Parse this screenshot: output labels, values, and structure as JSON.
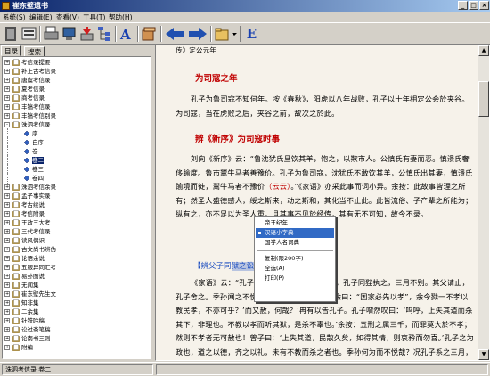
{
  "window": {
    "title": "崔东壁遗书"
  },
  "menu": [
    "系统(S)",
    "编辑(E)",
    "查看(V)",
    "工具(T)",
    "帮助(H)"
  ],
  "toolbar": {
    "e_label": "E"
  },
  "left_tabs": [
    "目录",
    "搜索"
  ],
  "tree": [
    {
      "label": "考信录提要",
      "depth": 0,
      "expander": "+"
    },
    {
      "label": "补上古考信录",
      "depth": 0,
      "expander": "+"
    },
    {
      "label": "唐虞考信录",
      "depth": 0,
      "expander": "+"
    },
    {
      "label": "夏考信录",
      "depth": 0,
      "expander": "+"
    },
    {
      "label": "商考信录",
      "depth": 0,
      "expander": "+"
    },
    {
      "label": "丰镐考信录",
      "depth": 0,
      "expander": "+"
    },
    {
      "label": "丰镐考信别录",
      "depth": 0,
      "expander": "+"
    },
    {
      "label": "洙泗考信录",
      "depth": 0,
      "expander": "-"
    },
    {
      "label": "序",
      "depth": 1,
      "expander": ""
    },
    {
      "label": "自序",
      "depth": 1,
      "expander": ""
    },
    {
      "label": "卷一",
      "depth": 1,
      "expander": ""
    },
    {
      "label": "卷二",
      "depth": 1,
      "expander": "",
      "selected": true
    },
    {
      "label": "卷三",
      "depth": 1,
      "expander": ""
    },
    {
      "label": "卷四",
      "depth": 1,
      "expander": ""
    },
    {
      "label": "洙泗考信余录",
      "depth": 0,
      "expander": "+"
    },
    {
      "label": "孟子事实录",
      "depth": 0,
      "expander": "+"
    },
    {
      "label": "考古续说",
      "depth": 0,
      "expander": "+"
    },
    {
      "label": "考信附录",
      "depth": 0,
      "expander": "+"
    },
    {
      "label": "王政三大考",
      "depth": 0,
      "expander": "+"
    },
    {
      "label": "三代考信录",
      "depth": 0,
      "expander": "+"
    },
    {
      "label": "读风偶识",
      "depth": 0,
      "expander": "+"
    },
    {
      "label": "古文尚书辨伪",
      "depth": 0,
      "expander": "+"
    },
    {
      "label": "论语余说",
      "depth": 0,
      "expander": "+"
    },
    {
      "label": "五服异同汇考",
      "depth": 0,
      "expander": "+"
    },
    {
      "label": "易卦图说",
      "depth": 0,
      "expander": "+"
    },
    {
      "label": "无闻集",
      "depth": 0,
      "expander": "+"
    },
    {
      "label": "崔东壁先生文",
      "depth": 0,
      "expander": "+"
    },
    {
      "label": "知非集",
      "depth": 0,
      "expander": "+"
    },
    {
      "label": "二余集",
      "depth": 0,
      "expander": "+"
    },
    {
      "label": "针铁吟稿",
      "depth": 0,
      "expander": "+"
    },
    {
      "label": "讼过斋笔稿",
      "depth": 0,
      "expander": "+"
    },
    {
      "label": "论南书三则",
      "depth": 0,
      "expander": "+"
    },
    {
      "label": "附编",
      "depth": 0,
      "expander": "+"
    }
  ],
  "doc": {
    "top_line": "传》定公元年",
    "heading1": "为司寇之年",
    "p1": "孔子为鲁司寇不知何年。按《春秋》，阳虎以八年战败，孔子以十年相定公会於夹谷。为司寇，当在虎败之后，夹谷之前，故次之於此。",
    "heading2": "辨《新序》为司寇时事",
    "p2_a": "刘向《新序》云：“鲁沈犹氏旦饮其羊，饱之，以欺市人。公慎氏有妻而恶。慎溃氏奢侈踰度。鲁市鬻牛马者善豫价。孔子为鲁司寇，沈犹氏不敢饮其羊，公慎氏出其妻，慎溃氏踰境而徙，鬻牛马者不豫价",
    "p2_cite": "（云云）",
    "p2_b": "。”《家语》亦采此事而词小异。余按：此故事皆理之所有；然圣人盛德感人，绥之斯来，动之斯和，其化当不止此。此皆流俗、子产辈之所能为；纵有之，亦不足以为圣人重。且其事不见於经传，其有无不可知，故今不录。",
    "heading3_a": "【辨父子同",
    "heading3_b": "狱之讼】",
    "p3": "《家语》云：“孔子为鲁大司寇，有父子讼者，孔子同狴执之，三月不别。其父请止，孔子舍之。季孙闻之不悦，曰：‘司寇欺余。曩告余曰：“国家必先以孝”，余今戮一不孝以教民孝，不亦可乎？’而又赦，何哉？’冉有以告孔子。孔子喟然叹曰：‘呜呼，上失其道而杀其下，非理也。不教以孝而听其狱，是杀不辜也。’余按：五刑之属三千，而罪莫大於不孝；然则不孝者无可赦也！曾子曰：‘上失其道，民散久矣，如得其情，则哀矜而勿喜。’孔子之为政也，道之以德，齐之以礼，未有不教而杀之者也。季孙何为而不悦哉？况孔子系之三月，乃欲待教而后刑乎！《家语》此文本之《荀子》，而《韩诗外传》亦有之，所载又与此异，云季孙欲杀而孔子止之，且以事为训，《宥坐》云：“不教其民而听其狱，杀不辜也。”又云“上失其道，民散久矣”，是以“如杀无辜”之言，而作之者过也。若《荀子》则又附闻异说者也。愚其意皆不过欲明圣人之以德化民耳，然言之不审，遂流入於异端而不自知。呜呼，说经引古又乌可以不"
  },
  "context_menu": {
    "items": [
      "帝王纪年",
      "汉语小字典",
      "国学人名词典",
      "复制(限200字)",
      "全选(A)",
      "打印(P)"
    ],
    "highlighted": 1
  },
  "status": {
    "path": "洙泗考信录 卷二"
  }
}
